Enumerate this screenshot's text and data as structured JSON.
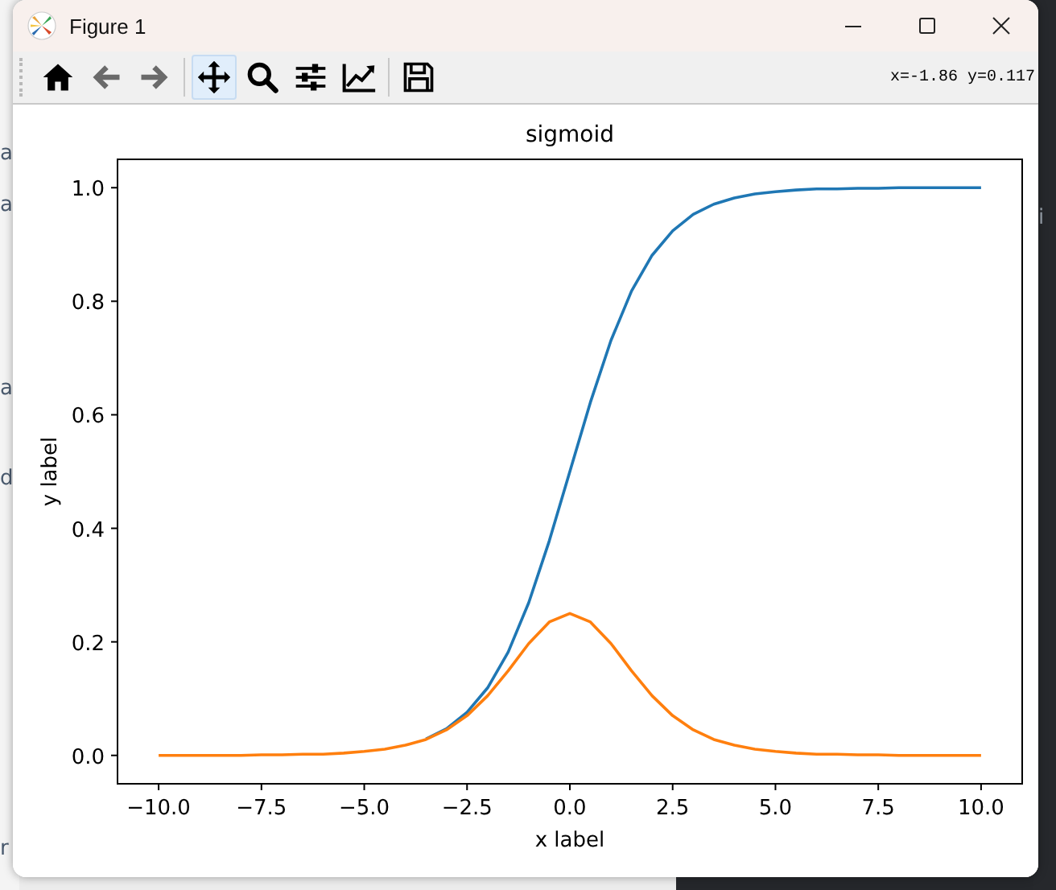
{
  "desktop": {
    "left_fragments": [
      "a",
      "a",
      "a",
      "d",
      "r"
    ],
    "right_fragments": [
      "i"
    ]
  },
  "window": {
    "title": "Figure 1"
  },
  "toolbar": {
    "items": [
      {
        "kind": "home",
        "selected": false,
        "disabled": false
      },
      {
        "kind": "back",
        "selected": false,
        "disabled": true
      },
      {
        "kind": "forward",
        "selected": false,
        "disabled": true
      },
      {
        "kind": "separator"
      },
      {
        "kind": "pan",
        "selected": true,
        "disabled": false
      },
      {
        "kind": "zoom",
        "selected": false,
        "disabled": false
      },
      {
        "kind": "configure",
        "selected": false,
        "disabled": false
      },
      {
        "kind": "edit",
        "selected": false,
        "disabled": false
      },
      {
        "kind": "separator"
      },
      {
        "kind": "save",
        "selected": false,
        "disabled": false
      }
    ],
    "coordinates": "x=-1.86 y=0.117"
  },
  "figure": {
    "chart_data": {
      "type": "line",
      "title": "sigmoid",
      "xlabel": "x label",
      "ylabel": "y label",
      "x": [
        -10,
        -9.5,
        -9,
        -8.5,
        -8,
        -7.5,
        -7,
        -6.5,
        -6,
        -5.5,
        -5,
        -4.5,
        -4,
        -3.5,
        -3,
        -2.5,
        -2,
        -1.5,
        -1,
        -0.5,
        0,
        0.5,
        1,
        1.5,
        2,
        2.5,
        3,
        3.5,
        4,
        4.5,
        5,
        5.5,
        6,
        6.5,
        7,
        7.5,
        8,
        8.5,
        9,
        9.5,
        10
      ],
      "series": [
        {
          "color": "#1f77b4",
          "values": [
            null,
            null,
            null,
            null,
            null,
            null,
            null,
            null,
            null,
            null,
            null,
            null,
            null,
            0.029,
            0.047,
            0.076,
            0.119,
            0.182,
            0.269,
            0.378,
            0.5,
            0.622,
            0.731,
            0.818,
            0.881,
            0.924,
            0.953,
            0.971,
            0.982,
            0.989,
            0.993,
            0.996,
            0.998,
            0.998,
            0.999,
            0.999,
            1.0,
            1.0,
            1.0,
            1.0,
            1.0
          ]
        },
        {
          "color": "#ff7f0e",
          "values": [
            0.0,
            0.0,
            0.0,
            0.0,
            0.0,
            0.001,
            0.001,
            0.002,
            0.002,
            0.004,
            0.007,
            0.011,
            0.018,
            0.028,
            0.045,
            0.07,
            0.105,
            0.149,
            0.197,
            0.235,
            0.25,
            0.235,
            0.197,
            0.149,
            0.105,
            0.07,
            0.045,
            0.028,
            0.018,
            0.011,
            0.007,
            0.004,
            0.002,
            0.002,
            0.001,
            0.001,
            0.0,
            0.0,
            0.0,
            0.0,
            0.0
          ]
        }
      ],
      "xlim": [
        -11,
        11
      ],
      "ylim": [
        -0.05,
        1.05
      ],
      "xticks": [
        {
          "value": -10,
          "label": "−10.0"
        },
        {
          "value": -7.5,
          "label": "−7.5"
        },
        {
          "value": -5,
          "label": "−5.0"
        },
        {
          "value": -2.5,
          "label": "−2.5"
        },
        {
          "value": 0,
          "label": "0.0"
        },
        {
          "value": 2.5,
          "label": "2.5"
        },
        {
          "value": 5,
          "label": "5.0"
        },
        {
          "value": 7.5,
          "label": "7.5"
        },
        {
          "value": 10,
          "label": "10.0"
        }
      ],
      "yticks": [
        {
          "value": 0,
          "label": "0.0"
        },
        {
          "value": 0.2,
          "label": "0.2"
        },
        {
          "value": 0.4,
          "label": "0.4"
        },
        {
          "value": 0.6,
          "label": "0.6"
        },
        {
          "value": 0.8,
          "label": "0.8"
        },
        {
          "value": 1.0,
          "label": "1.0"
        }
      ]
    }
  }
}
